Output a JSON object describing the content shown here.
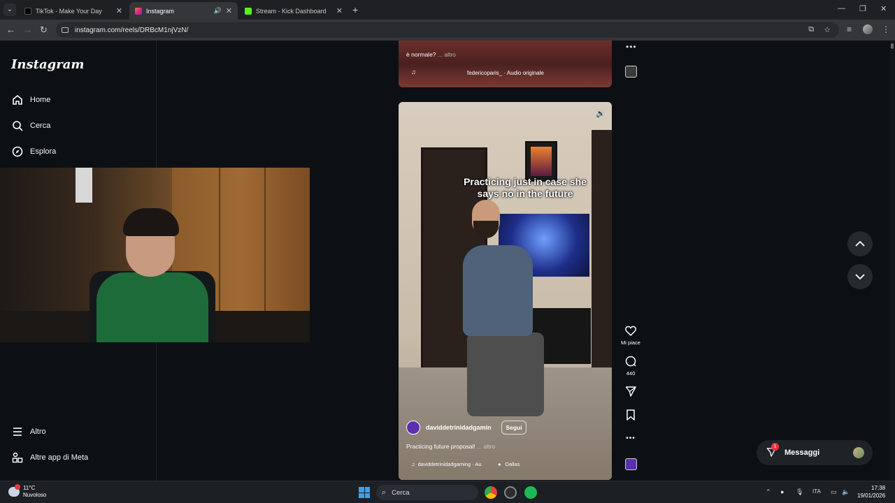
{
  "browser": {
    "tabs": [
      {
        "label": "TikTok - Make Your Day",
        "favicon_color": "#000000"
      },
      {
        "label": "Instagram",
        "favicon_color": "#e1306c"
      },
      {
        "label": "Stream - Kick Dashboard",
        "favicon_color": "#53fc18"
      }
    ],
    "url": "instagram.com/reels/DRBcM1njVzN/"
  },
  "sidebar": {
    "logo": "Instagram",
    "items": [
      {
        "label": "Home",
        "icon": "home-icon"
      },
      {
        "label": "Cerca",
        "icon": "search-icon"
      },
      {
        "label": "Esplora",
        "icon": "compass-icon"
      }
    ],
    "bottom_items": [
      {
        "label": "Altro",
        "icon": "menu-icon"
      },
      {
        "label": "Altre app di Meta",
        "icon": "apps-icon"
      }
    ]
  },
  "prev_reel": {
    "caption": "è normale?",
    "more": "... altro",
    "audio": "federicoparis_ · Audio originale"
  },
  "reel": {
    "overlay_text": "Practicing just in case she says no in the future",
    "username": "daviddetrinidadgamin",
    "follow_label": "Segui",
    "description": "Practicing future proposal!",
    "more": "... altro",
    "audio": "daviddetrinidadgaming · Au",
    "location": "Dallas"
  },
  "actions": {
    "like_label": "Mi piace",
    "comments_count": "440"
  },
  "messages": {
    "label": "Messaggi",
    "badge": "1"
  },
  "taskbar": {
    "weather_temp": "11°C",
    "weather_desc": "Nuvoloso",
    "search_placeholder": "Cerca",
    "language": "ITA",
    "time": "17:38",
    "date": "19/01/2026"
  },
  "colors": {
    "background": "#0c1014",
    "accent_badge": "#ff3040"
  }
}
